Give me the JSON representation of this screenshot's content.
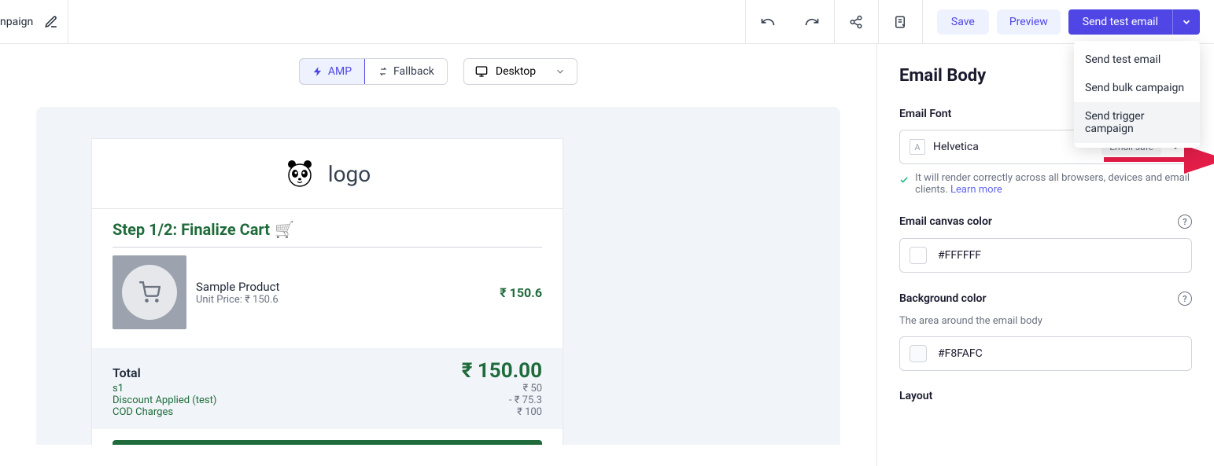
{
  "header": {
    "title_partial": "npaign",
    "save_label": "Save",
    "preview_label": "Preview",
    "send_test_label": "Send test email",
    "dropdown": {
      "item1": "Send test email",
      "item2": "Send bulk campaign",
      "item3": "Send trigger campaign"
    }
  },
  "canvas_toolbar": {
    "amp_label": "AMP",
    "fallback_label": "Fallback",
    "device_label": "Desktop"
  },
  "email_preview": {
    "logo_text": "logo",
    "step_title": "Step 1/2: Finalize Cart",
    "cart_emoji": "🛒",
    "product": {
      "name": "Sample Product",
      "unit_price_label": "Unit Price: ₹ 150.6",
      "line_price": "₹ 150.6"
    },
    "totals": {
      "total_label": "Total",
      "total_value": "₹ 150.00",
      "rows": [
        {
          "label": "s1",
          "value": "₹ 50"
        },
        {
          "label": "Discount Applied (test)",
          "value": "- ₹ 75.3"
        },
        {
          "label": "COD Charges",
          "value": "₹ 100"
        }
      ]
    }
  },
  "sidebar": {
    "heading": "Email Body",
    "font_section_label": "Email Font",
    "font_value": "Helvetica",
    "email_safe_badge": "Email safe",
    "font_helper": "It will render correctly across all browsers, devices and email clients. ",
    "learn_more": "Learn more",
    "canvas_color_label": "Email canvas color",
    "canvas_color_value": "#FFFFFF",
    "bg_color_label": "Background color",
    "bg_color_desc": "The area around the email body",
    "bg_color_value": "#F8FAFC",
    "layout_label": "Layout"
  }
}
